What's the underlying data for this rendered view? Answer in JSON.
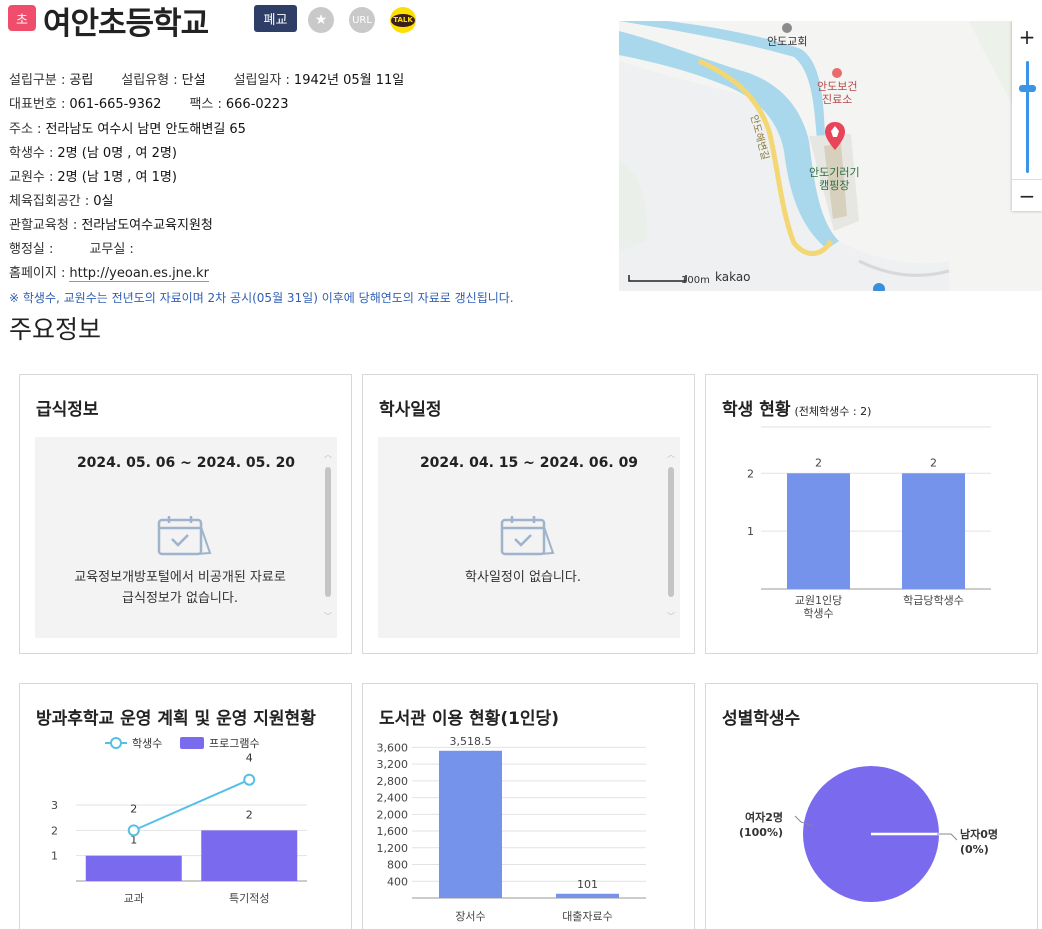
{
  "school": {
    "level_badge": "초",
    "name": "여안초등학교",
    "status_badge": "폐교",
    "url_label": "URL",
    "talk_label": "TALK"
  },
  "info": {
    "found_type_label": "설립구분 :",
    "found_type": "공립",
    "found_kind_label": "설립유형 :",
    "found_kind": "단설",
    "found_date_label": "설립일자 :",
    "found_date": "1942년 05월 11일",
    "phone_label": "대표번호 :",
    "phone": "061-665-9362",
    "fax_label": "팩스 :",
    "fax": "666-0223",
    "address_label": "주소 :",
    "address": "전라남도 여수시 남면 안도해변길 65",
    "students_label": "학생수 :",
    "students": "2명 (남 0명 , 여 2명)",
    "teachers_label": "교원수 :",
    "teachers": "2명 (남 1명 , 여 1명)",
    "gym_label": "체육집회공간 :",
    "gym": "0실",
    "office_label": "관할교육청 :",
    "office": "전라남도여수교육지원청",
    "admin_label": "행정실 :",
    "staff_label": "교무실 :",
    "homepage_label": "홈페이지 :",
    "homepage": "http://yeoan.es.jne.kr",
    "notice": "※ 학생수, 교원수는 전년도의 자료이며 2차 공시(05월 31일) 이후에 당해연도의 자료로 갱신됩니다."
  },
  "map": {
    "church": "안도교회",
    "clinic_line1": "안도보건",
    "clinic_line2": "진료소",
    "camp_line1": "안도기러기",
    "camp_line2": "캠핑장",
    "road": "안도해변길",
    "scale": "100m",
    "brand": "kakao",
    "zoom_in": "+",
    "zoom_out": "−"
  },
  "section_title": "주요정보",
  "meal": {
    "title": "급식정보",
    "range": "2024. 05. 06 ~ 2024. 05. 20",
    "empty_line1": "교육정보개방포털에서 비공개된 자료로",
    "empty_line2": "급식정보가 없습니다."
  },
  "schedule": {
    "title": "학사일정",
    "range": "2024. 04. 15 ~ 2024. 06. 09",
    "empty": "학사일정이 없습니다."
  },
  "student_status": {
    "title": "학생 현황",
    "subtitle": "(전체학생수 : 2)"
  },
  "afterschool": {
    "title": "방과후학교 운영 계획 및 운영 지원현황"
  },
  "library": {
    "title": "도서관 이용 현황(1인당)"
  },
  "gender": {
    "title": "성별학생수"
  },
  "chart_data": [
    {
      "type": "bar",
      "categories": [
        "교원1인당 학생수",
        "학급당학생수"
      ],
      "values": [
        2,
        2
      ],
      "yticks": [
        1,
        2
      ],
      "ylim": [
        0,
        2.8
      ],
      "color": "#7593ea"
    },
    {
      "type": "bar+line",
      "categories": [
        "교과",
        "특기적성"
      ],
      "series": [
        {
          "name": "학생수",
          "type": "line",
          "values": [
            2,
            4
          ],
          "color": "#56bfe6"
        },
        {
          "name": "프로그램수",
          "type": "bar",
          "values": [
            1,
            2
          ],
          "color": "#7a6bee"
        }
      ],
      "yticks": [
        1,
        2,
        3
      ],
      "ylim": [
        0,
        4.7
      ]
    },
    {
      "type": "bar",
      "categories": [
        "장서수",
        "대출자료수"
      ],
      "values": [
        3518.5,
        101
      ],
      "value_labels": [
        "3,518.5",
        "101"
      ],
      "yticks": [
        400,
        800,
        1200,
        1600,
        2000,
        2400,
        2800,
        3200,
        3600
      ],
      "ytick_labels": [
        "400",
        "800",
        "1,200",
        "1,600",
        "2,000",
        "2,400",
        "2,800",
        "3,200",
        "3,600"
      ],
      "ylim": [
        0,
        3800
      ],
      "color": "#7593ea"
    },
    {
      "type": "pie",
      "slices": [
        {
          "label": "여자2명",
          "pct_label": "(100%)",
          "value": 100,
          "color": "#7a6bee"
        },
        {
          "label": "남자0명",
          "pct_label": "(0%)",
          "value": 0,
          "color": "#ffffff"
        }
      ]
    }
  ]
}
